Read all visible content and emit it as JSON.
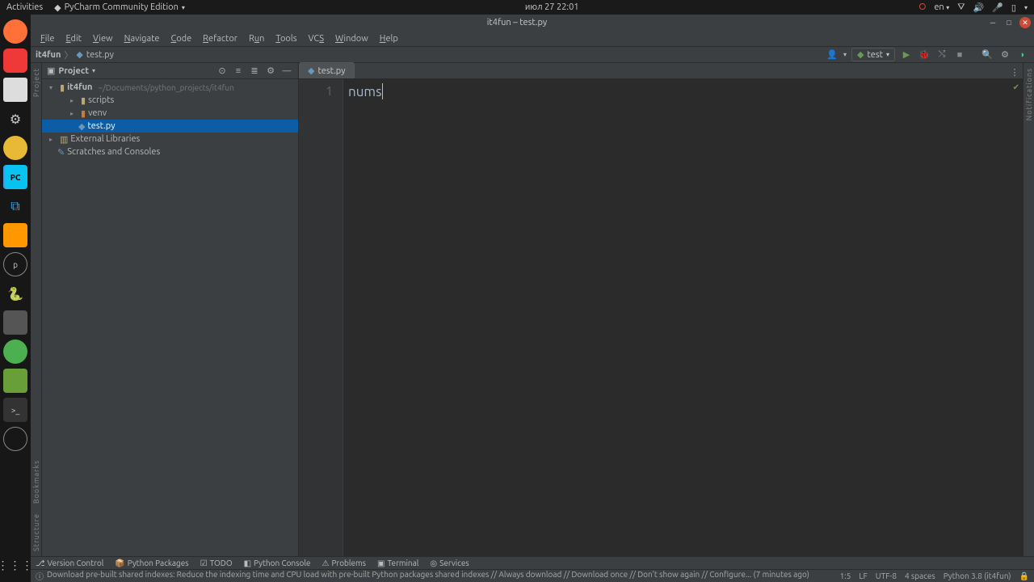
{
  "gnome": {
    "activities": "Activities",
    "app_name": "PyCharm Community Edition",
    "clock": "июл 27  22:01",
    "lang": "en"
  },
  "titlebar": {
    "title": "it4fun – test.py"
  },
  "menu": {
    "file": "File",
    "edit": "Edit",
    "view": "View",
    "navigate": "Navigate",
    "code": "Code",
    "refactor": "Refactor",
    "run": "Run",
    "tools": "Tools",
    "vcs": "VCS",
    "window": "Window",
    "help": "Help"
  },
  "breadcrumb": {
    "root": "it4fun",
    "file": "test.py"
  },
  "run_config": {
    "name": "test"
  },
  "project_header": {
    "label": "Project"
  },
  "tree": {
    "root": {
      "name": "it4fun",
      "path": "~/Documents/python_projects/it4fun"
    },
    "scripts": "scripts",
    "venv": "venv",
    "testpy": "test.py",
    "ext": "External Libraries",
    "scratch": "Scratches and Consoles"
  },
  "tool_stripe": {
    "project": "Project",
    "bookmarks": "Bookmarks",
    "structure": "Structure",
    "notifications": "Notifications"
  },
  "editor": {
    "tab_label": "test.py",
    "line_number": "1",
    "code_line1": "nums"
  },
  "bottom": {
    "vcs": "Version Control",
    "pkg": "Python Packages",
    "todo": "TODO",
    "console": "Python Console",
    "problems": "Problems",
    "terminal": "Terminal",
    "services": "Services"
  },
  "status": {
    "msg_prefix": "Download pre-built shared indexes: Reduce the indexing time and CPU load with pre-built Python packages shared indexes // Always download // Download once // Don't show again // Configure... (7 minutes ago)",
    "pos": "1:5",
    "lineend": "LF",
    "encoding": "UTF-8",
    "indent": "4 spaces",
    "interpreter": "Python 3.8 (it4fun)"
  }
}
